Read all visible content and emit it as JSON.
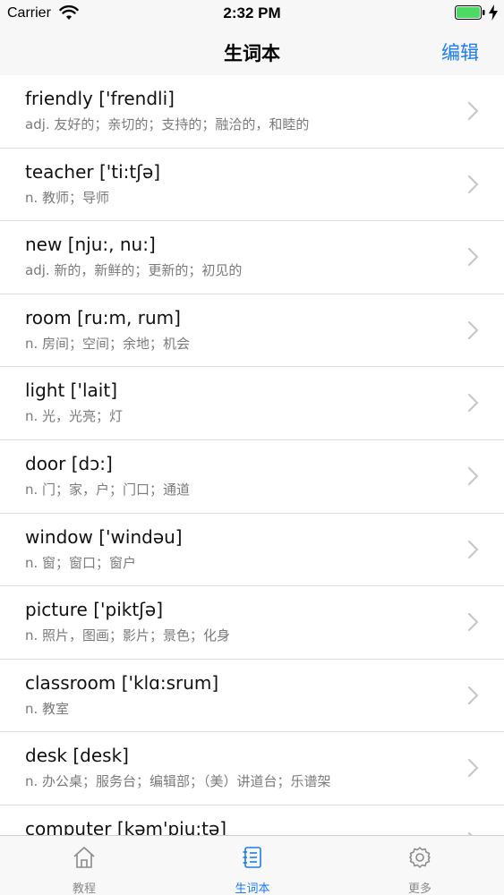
{
  "status_bar": {
    "carrier": "Carrier",
    "time": "2:32 PM"
  },
  "nav": {
    "title": "生词本",
    "edit_label": "编辑"
  },
  "words": [
    {
      "word": "friendly ['frendli]",
      "meaning": "adj. 友好的；亲切的；支持的；融洽的，和睦的"
    },
    {
      "word": "teacher ['ti:tʃə]",
      "meaning": "n. 教师；导师"
    },
    {
      "word": "new [nju:, nu:]",
      "meaning": "adj. 新的，新鲜的；更新的；初见的"
    },
    {
      "word": "room [ru:m, rum]",
      "meaning": "n. 房间；空间；余地；机会"
    },
    {
      "word": "light ['lait]",
      "meaning": "n. 光，光亮；灯"
    },
    {
      "word": "door [dɔ:]",
      "meaning": "n. 门；家，户；门口；通道"
    },
    {
      "word": "window ['windəu]",
      "meaning": "n. 窗；窗口；窗户"
    },
    {
      "word": "picture ['piktʃə]",
      "meaning": "n. 照片，图画；影片；景色；化身"
    },
    {
      "word": "classroom ['klɑ:srum]",
      "meaning": "n. 教室"
    },
    {
      "word": "desk [desk]",
      "meaning": "n. 办公桌；服务台；编辑部；（美）讲道台；乐谱架"
    },
    {
      "word": "computer [kəm'pju:tə]",
      "meaning": ""
    }
  ],
  "tabs": [
    {
      "label": "教程",
      "icon": "home-icon",
      "active": false
    },
    {
      "label": "生词本",
      "icon": "notebook-icon",
      "active": true
    },
    {
      "label": "更多",
      "icon": "gear-icon",
      "active": false
    }
  ],
  "colors": {
    "accent": "#1a7cf2",
    "inactive": "#8a8a8a",
    "battery": "#4cd964"
  }
}
